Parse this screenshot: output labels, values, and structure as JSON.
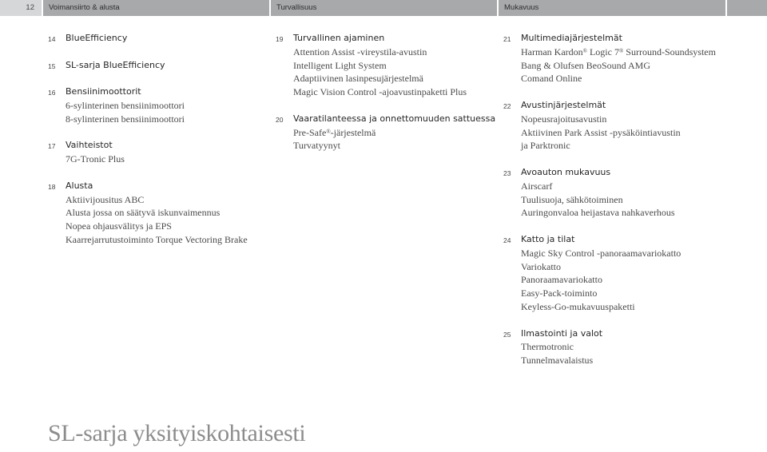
{
  "header": {
    "page_number": "12",
    "sections": [
      "Voimansiirto & alusta",
      "Turvallisuus",
      "Mukavuus",
      ""
    ]
  },
  "columns": [
    {
      "sections": [
        {
          "num": "14",
          "heading": "BlueEfficiency",
          "items": []
        },
        {
          "num": "15",
          "heading": "SL-sarja BlueEfficiency",
          "items": []
        },
        {
          "num": "16",
          "heading": "Bensiinimoottorit",
          "items": [
            "6-sylinterinen bensiinimoottori",
            "8-sylinterinen bensiinimoottori"
          ]
        },
        {
          "num": "17",
          "heading": "Vaihteistot",
          "items": [
            "7G-Tronic Plus"
          ]
        },
        {
          "num": "18",
          "heading": "Alusta",
          "items": [
            "Aktiivijousitus ABC",
            "Alusta jossa on säätyvä iskunvaimennus",
            "Nopea ohjausvälitys ja EPS",
            "Kaarrejarrutustoiminto Torque Vectoring Brake"
          ]
        }
      ]
    },
    {
      "sections": [
        {
          "num": "19",
          "heading": "Turvallinen ajaminen",
          "items": [
            "Attention Assist -vireystila-avustin",
            "Intelligent Light System",
            "Adaptiivinen lasinpesujärjestelmä",
            "Magic Vision Control -ajoavustinpaketti Plus"
          ]
        },
        {
          "num": "20",
          "heading": "Vaaratilanteessa ja onnettomuuden sattuessa",
          "items": [
            "Pre-Safe®-järjestelmä",
            "Turvatyynyt"
          ]
        }
      ]
    },
    {
      "sections": [
        {
          "num": "21",
          "heading": "Multimediajärjestelmät",
          "items": [
            "Harman Kardon® Logic 7® Surround-Soundsystem",
            "Bang & Olufsen BeoSound AMG",
            "Comand Online"
          ]
        },
        {
          "num": "22",
          "heading": "Avustinjärjestelmät",
          "items": [
            "Nopeusrajoitusavustin",
            "Aktiivinen Park Assist -pysäköintiavustin",
            "ja Parktronic"
          ]
        },
        {
          "num": "23",
          "heading": "Avoauton mukavuus",
          "items": [
            "Airscarf",
            "Tuulisuoja, sähkötoiminen",
            "Auringonvaloa heijastava nahkaverhous"
          ]
        },
        {
          "num": "24",
          "heading": "Katto ja tilat",
          "items": [
            "Magic Sky Control -panoraamavariokatto",
            "Variokatto",
            "Panoraamavariokatto",
            "Easy-Pack-toiminto",
            "Keyless-Go-mukavuuspaketti"
          ]
        },
        {
          "num": "25",
          "heading": "Ilmastointi ja valot",
          "items": [
            "Thermotronic",
            "Tunnelmavalaistus"
          ]
        }
      ]
    }
  ],
  "footer": {
    "title": "SL-sarja yksityiskohtaisesti"
  }
}
